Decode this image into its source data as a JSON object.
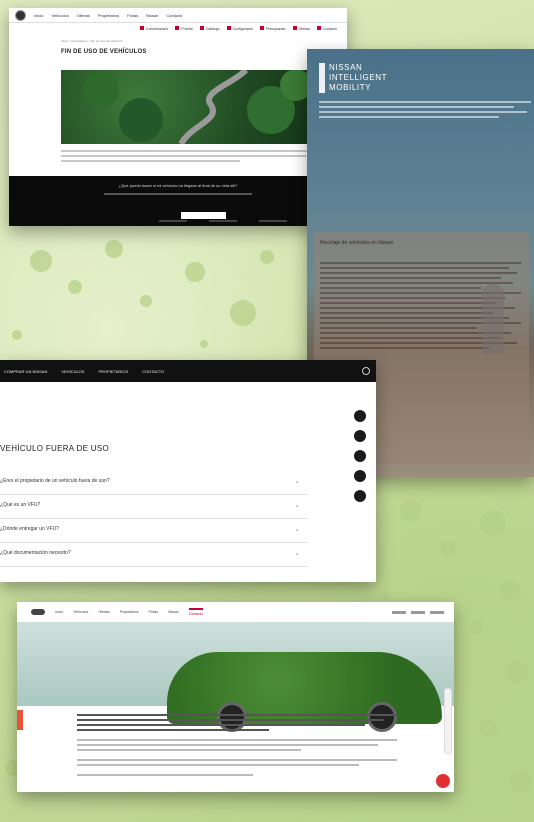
{
  "s1": {
    "nav": [
      "Inicio",
      "Vehículos",
      "Ofertas",
      "Propietarios",
      "Flotas",
      "Nissan",
      "Contacto"
    ],
    "subnav": [
      "Concesionario",
      "Prueba",
      "Catálogo",
      "Configurador",
      "Presupuesto",
      "Ofertas",
      "Contacto"
    ],
    "crumb": "Inicio > Propietarios > Fin de Uso del Vehículo",
    "title": "FIN DE USO DE VEHÍCULOS",
    "question": "¿Qué puedo hacer si mi vehículo ha llegado al final de su vida útil?",
    "button": "CONTACTAR"
  },
  "s2": {
    "brand": [
      "NISSAN",
      "INTELLIGENT",
      "MOBILITY"
    ],
    "card_title": "Reciclaje de vehículos en Nissan"
  },
  "s3": {
    "top": [
      "COMPRAR UN NISSAN",
      "VEHÍCULOS",
      "PROPIETARIOS",
      "CONTACTO"
    ],
    "heading": "VEHÍCULO FUERA DE USO",
    "rows": [
      "¿Eres el propietario de un vehículo fuera de uso?",
      "¿Qué es un VFU?",
      "¿Dónde entregar un VFU?",
      "¿Qué documentación necesito?"
    ]
  },
  "s4": {
    "nav": [
      "Inicio",
      "Vehículos",
      "Ofertas",
      "Propietarios",
      "Flotas",
      "Nissan",
      "Contacto"
    ],
    "active": "Contacto"
  }
}
